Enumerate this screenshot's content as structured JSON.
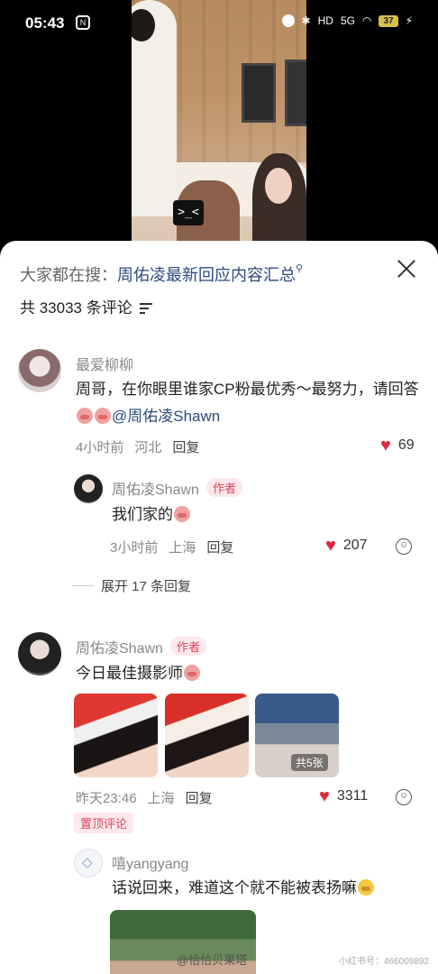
{
  "status_bar": {
    "time": "05:43",
    "battery": "37",
    "signal": "5G",
    "hd": "HD"
  },
  "video": {
    "overlay_text": ">_<"
  },
  "header": {
    "search_prefix": "大家都在搜：",
    "search_keyword": "周佑凌最新回应内容汇总",
    "comment_count": "共 33033 条评论"
  },
  "comments": [
    {
      "user": "最爱柳柳",
      "text_before": "周哥，在你眼里谁家CP粉最优秀～最努力，请回答",
      "mention": "@周佑凌Shawn",
      "time": "4小时前",
      "location": "河北",
      "reply_label": "回复",
      "likes": "69",
      "replies": [
        {
          "user": "周佑凌Shawn",
          "badge": "作者",
          "text": "我们家的",
          "time": "3小时前",
          "location": "上海",
          "reply_label": "回复",
          "likes": "207"
        }
      ],
      "expand_label": "展开 17 条回复"
    },
    {
      "user": "周佑凌Shawn",
      "badge": "作者",
      "text": "今日最佳摄影师",
      "time": "昨天23:46",
      "location": "上海",
      "reply_label": "回复",
      "likes": "3311",
      "photo_more": "共5张",
      "pinned": "置顶评论",
      "replies": [
        {
          "user": "嘻yangyang",
          "text": "话说回来，难道这个就不能被表扬嘛"
        }
      ]
    }
  ],
  "watermark": {
    "weibo": "@恰恰贝果塔",
    "id": "小红书号：466009892"
  },
  "colors": {
    "accent_red": "#e0283e",
    "link_blue": "#2c4a7e",
    "badge_bg": "#fde8ec"
  }
}
